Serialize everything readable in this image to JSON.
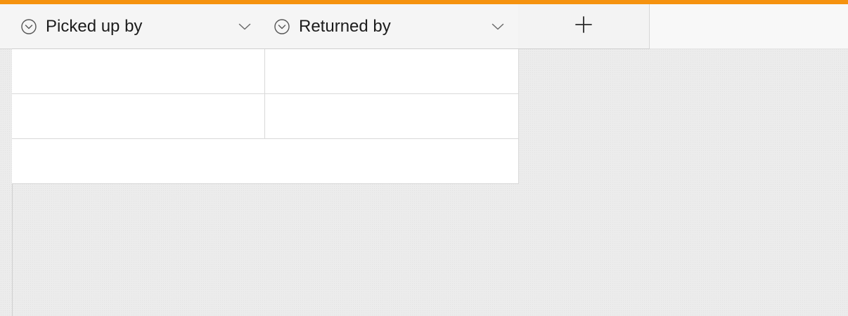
{
  "theme": {
    "accent": "#f5920f",
    "header_bg": "#f5f5f5",
    "cell_bg": "#ffffff",
    "border": "#d9d9d9",
    "canvas_bg": "#ececec"
  },
  "columns": [
    {
      "label": "Picked up by",
      "icon": "circle-chevron-down-icon",
      "menu_icon": "chevron-down-icon"
    },
    {
      "label": "Returned by",
      "icon": "circle-chevron-down-icon",
      "menu_icon": "chevron-down-icon"
    }
  ],
  "add_column": {
    "icon": "plus-icon"
  },
  "rows": [
    {
      "cells": [
        "",
        ""
      ]
    },
    {
      "cells": [
        "",
        ""
      ]
    }
  ],
  "add_row": {
    "label": ""
  }
}
